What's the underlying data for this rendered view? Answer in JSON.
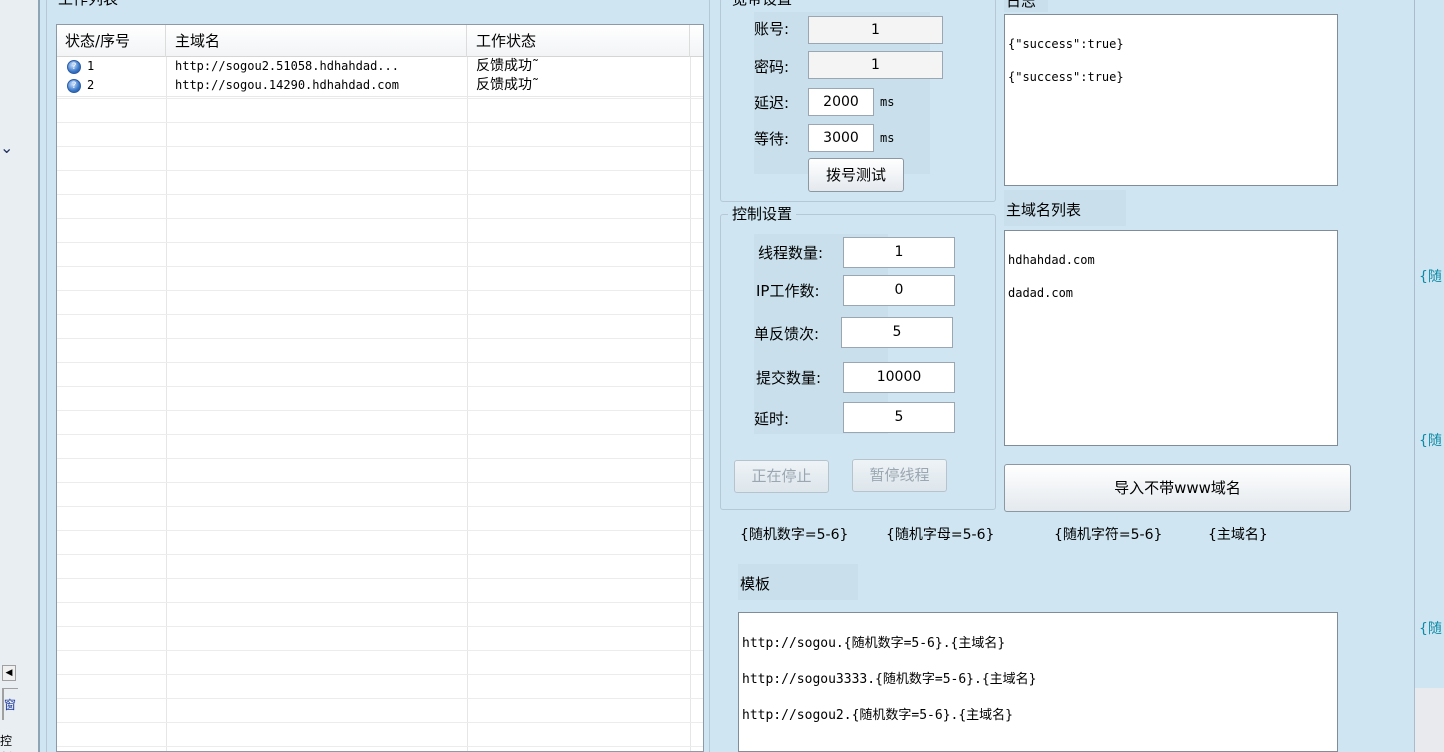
{
  "work_list": {
    "title": "工作列表",
    "columns": [
      "状态/序号",
      "主域名",
      "工作状态"
    ],
    "rows": [
      {
        "index": "1",
        "domain": "http://sogou2.51058.hdhahdad...",
        "status": "反馈成功˜"
      },
      {
        "index": "2",
        "domain": "http://sogou.14290.hdhahdad.com",
        "status": "反馈成功˜"
      }
    ]
  },
  "broadband": {
    "title": "宽带设置",
    "account_label": "账号:",
    "account_value": "1",
    "password_label": "密码:",
    "password_value": "1",
    "delay_label": "延迟:",
    "delay_value": "2000",
    "wait_label": "等待:",
    "wait_value": "3000",
    "unit_ms": "ms",
    "dial_test_button": "拨号测试"
  },
  "control": {
    "title": "控制设置",
    "threads_label": "线程数量:",
    "threads_value": "1",
    "ip_work_label": "IP工作数:",
    "ip_work_value": "0",
    "single_feedback_label": "单反馈次:",
    "single_feedback_value": "5",
    "submit_count_label": "提交数量:",
    "submit_count_value": "10000",
    "delay_label": "延时:",
    "delay_value": "5",
    "stopping_button": "正在停止",
    "pause_button": "暂停线程"
  },
  "log": {
    "title": "日志",
    "lines": [
      "{\"success\":true}",
      "{\"success\":true}"
    ]
  },
  "domain_list": {
    "title": "主域名列表",
    "lines": [
      "hdhahdad.com",
      "dadad.com"
    ],
    "import_button": "导入不带www域名"
  },
  "template_hints": [
    "{随机数字=5-6}",
    "{随机字母=5-6}",
    "{随机字符=5-6}",
    "{主域名}"
  ],
  "template": {
    "title": "模板",
    "lines": [
      "http://sogou.{随机数字=5-6}.{主域名}",
      "http://sogou3333.{随机数字=5-6}.{主域名}",
      "http://sogou2.{随机数字=5-6}.{主域名}"
    ]
  },
  "right_edge_hints": [
    "{随",
    "{随",
    "{随"
  ],
  "left_edge": {
    "tab1": "窗",
    "tab2": "控制"
  }
}
